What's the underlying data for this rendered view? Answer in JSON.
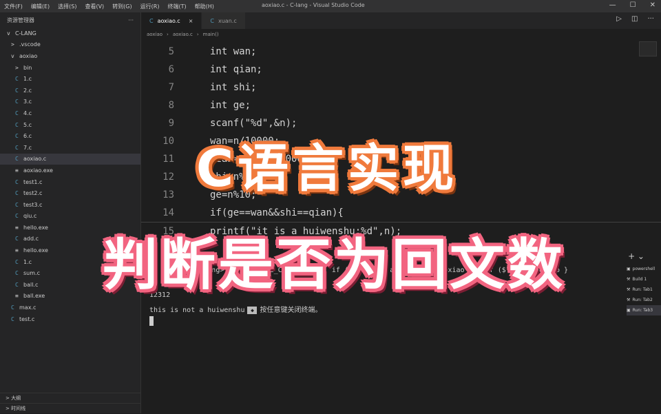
{
  "window": {
    "menu": [
      "文件(F)",
      "编辑(E)",
      "选择(S)",
      "查看(V)",
      "转到(G)",
      "运行(R)",
      "终端(T)",
      "帮助(H)"
    ],
    "title": "aoxiao.c - C-lang - Visual Studio Code"
  },
  "sidebar": {
    "header": "资源管理器",
    "more": "···",
    "items": [
      {
        "icon": "v",
        "label": "C-LANG"
      },
      {
        "icon": ">",
        "label": ".vscode"
      },
      {
        "icon": "v",
        "label": "aoxiao"
      },
      {
        "icon": ">",
        "label": "bin"
      },
      {
        "icon": "C",
        "label": "1.c"
      },
      {
        "icon": "C",
        "label": "2.c"
      },
      {
        "icon": "C",
        "label": "3.c"
      },
      {
        "icon": "C",
        "label": "4.c"
      },
      {
        "icon": "C",
        "label": "5.c"
      },
      {
        "icon": "C",
        "label": "6.c"
      },
      {
        "icon": "C",
        "label": "7.c"
      },
      {
        "icon": "C",
        "label": "aoxiao.c",
        "selected": true
      },
      {
        "icon": "≡",
        "label": "aoxiao.exe"
      },
      {
        "icon": "C",
        "label": "test1.c"
      },
      {
        "icon": "C",
        "label": "test2.c"
      },
      {
        "icon": "C",
        "label": "test3.c"
      },
      {
        "icon": "C",
        "label": "qiu.c"
      },
      {
        "icon": "≡",
        "label": "hello.exe"
      },
      {
        "icon": "C",
        "label": "add.c"
      },
      {
        "icon": "≡",
        "label": "hello.exe"
      },
      {
        "icon": "C",
        "label": "1.c"
      },
      {
        "icon": "C",
        "label": "sum.c"
      },
      {
        "icon": "C",
        "label": "ball.c"
      },
      {
        "icon": "≡",
        "label": "ball.exe"
      },
      {
        "icon": "C",
        "label": "max.c"
      },
      {
        "icon": "C",
        "label": "test.c"
      }
    ],
    "footer": [
      "> 大纲",
      "> 时间线"
    ]
  },
  "tabs": [
    {
      "label": "aoxiao.c",
      "active": true
    },
    {
      "label": "xuan.c",
      "active": false
    }
  ],
  "breadcrumb": [
    "aoxiao",
    "aoxiao.c",
    "main()"
  ],
  "code": [
    {
      "n": "5",
      "text": "int wan;"
    },
    {
      "n": "6",
      "text": "int qian;"
    },
    {
      "n": "7",
      "text": "int shi;"
    },
    {
      "n": "8",
      "text": "int ge;"
    },
    {
      "n": "9",
      "text": "scanf(\"%d\",&n);"
    },
    {
      "n": "10",
      "text": "wan=n/10000;"
    },
    {
      "n": "11",
      "text": "qian=n%1000/1000;"
    },
    {
      "n": "12",
      "text": "shi=n%100/10;"
    },
    {
      "n": "13",
      "text": "ge=n%10;"
    },
    {
      "n": "14",
      "text": "if(ge==wan&&shi==qian){"
    },
    {
      "n": "15",
      "text": "printf(\"it is a huiwenshu:%d\",n);"
    }
  ],
  "terminal": {
    "plus": "+ ⌄",
    "line_path": "PS D:\\Code\\C-lang> cd \"d:\\Code_C\\aoxiao\\\" ; if ($?) { gcc aoxiao.c -o aoxiao } ; if ($?) { .\\aoxiao }",
    "line_input": "12312",
    "line_output_a": "this is not a huiwenshu",
    "cursor_char": "◆",
    "line_output_b": "按任意键关闭终端。",
    "sessions": [
      "powershell",
      "Build 1",
      "Run: Tab1",
      "Run: Tab2",
      "Run: Tab3"
    ]
  },
  "overlay": {
    "line1": "C语言实现",
    "line2": "判断是否为回文数",
    "color1": "#f07a3c",
    "color2": "#f26480"
  }
}
